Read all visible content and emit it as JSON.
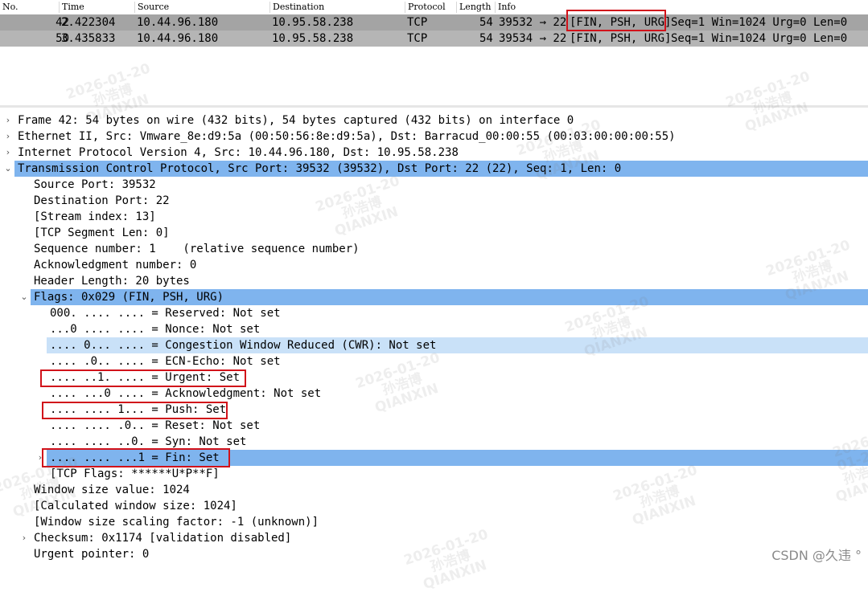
{
  "packet_list": {
    "columns": [
      "No.",
      "Time",
      "Source",
      "Destination",
      "Protocol",
      "Length",
      "Info"
    ],
    "rows": [
      {
        "no": "42",
        "time": "2.422304",
        "source": "10.44.96.180",
        "destination": "10.95.58.238",
        "protocol": "TCP",
        "length": "54",
        "ports": "39532 → 22",
        "flags": "[FIN, PSH, URG]",
        "rest": "Seq=1 Win=1024 Urg=0 Len=0"
      },
      {
        "no": "50",
        "time": "3.435833",
        "source": "10.44.96.180",
        "destination": "10.95.58.238",
        "protocol": "TCP",
        "length": "54",
        "ports": "39534 → 22",
        "flags": "[FIN, PSH, URG]",
        "rest": "Seq=1 Win=1024 Urg=0 Len=0"
      }
    ]
  },
  "details": [
    {
      "text": "Frame 42: 54 bytes on wire (432 bits), 54 bytes captured (432 bits) on interface 0",
      "arrow": "›",
      "state": ""
    },
    {
      "text": "Ethernet II, Src: Vmware_8e:d9:5a (00:50:56:8e:d9:5a), Dst: Barracud_00:00:55 (00:03:00:00:00:55)",
      "arrow": "›",
      "state": ""
    },
    {
      "text": "Internet Protocol Version 4, Src: 10.44.96.180, Dst: 10.95.58.238",
      "arrow": "›",
      "state": ""
    },
    {
      "text": "Transmission Control Protocol, Src Port: 39532 (39532), Dst Port: 22 (22), Seq: 1, Len: 0",
      "arrow": "⌄",
      "state": "sel"
    },
    {
      "text": "Source Port: 39532",
      "arrow": "",
      "state": ""
    },
    {
      "text": "Destination Port: 22",
      "arrow": "",
      "state": ""
    },
    {
      "text": "[Stream index: 13]",
      "arrow": "",
      "state": ""
    },
    {
      "text": "[TCP Segment Len: 0]",
      "arrow": "",
      "state": ""
    },
    {
      "text": "Sequence number: 1    (relative sequence number)",
      "arrow": "",
      "state": ""
    },
    {
      "text": "Acknowledgment number: 0",
      "arrow": "",
      "state": ""
    },
    {
      "text": "Header Length: 20 bytes",
      "arrow": "",
      "state": ""
    },
    {
      "text": "Flags: 0x029 (FIN, PSH, URG)",
      "arrow": "⌄",
      "state": "sel"
    },
    {
      "text": "000. .... .... = Reserved: Not set",
      "arrow": "",
      "state": ""
    },
    {
      "text": "...0 .... .... = Nonce: Not set",
      "arrow": "",
      "state": ""
    },
    {
      "text": ".... 0... .... = Congestion Window Reduced (CWR): Not set",
      "arrow": "",
      "state": "hl"
    },
    {
      "text": ".... .0.. .... = ECN-Echo: Not set",
      "arrow": "",
      "state": ""
    },
    {
      "text": ".... ..1. .... = Urgent: Set",
      "arrow": "",
      "state": ""
    },
    {
      "text": ".... ...0 .... = Acknowledgment: Not set",
      "arrow": "",
      "state": ""
    },
    {
      "text": ".... .... 1... = Push: Set",
      "arrow": "",
      "state": ""
    },
    {
      "text": ".... .... .0.. = Reset: Not set",
      "arrow": "",
      "state": ""
    },
    {
      "text": ".... .... ..0. = Syn: Not set",
      "arrow": "",
      "state": ""
    },
    {
      "text": ".... .... ...1 = Fin: Set",
      "arrow": "›",
      "state": "sel"
    },
    {
      "text": "[TCP Flags: ******U*P**F]",
      "arrow": "",
      "state": ""
    },
    {
      "text": "Window size value: 1024",
      "arrow": "",
      "state": ""
    },
    {
      "text": "[Calculated window size: 1024]",
      "arrow": "",
      "state": ""
    },
    {
      "text": "[Window size scaling factor: -1 (unknown)]",
      "arrow": "",
      "state": ""
    },
    {
      "text": "Checksum: 0x1174 [validation disabled]",
      "arrow": "›",
      "state": ""
    },
    {
      "text": "Urgent pointer: 0",
      "arrow": "",
      "state": ""
    }
  ],
  "watermark": {
    "date": "2026-01-20",
    "name": "孙浩博",
    "org": "QIANXIN"
  },
  "footer": {
    "credit": "CSDN @久违 °"
  }
}
